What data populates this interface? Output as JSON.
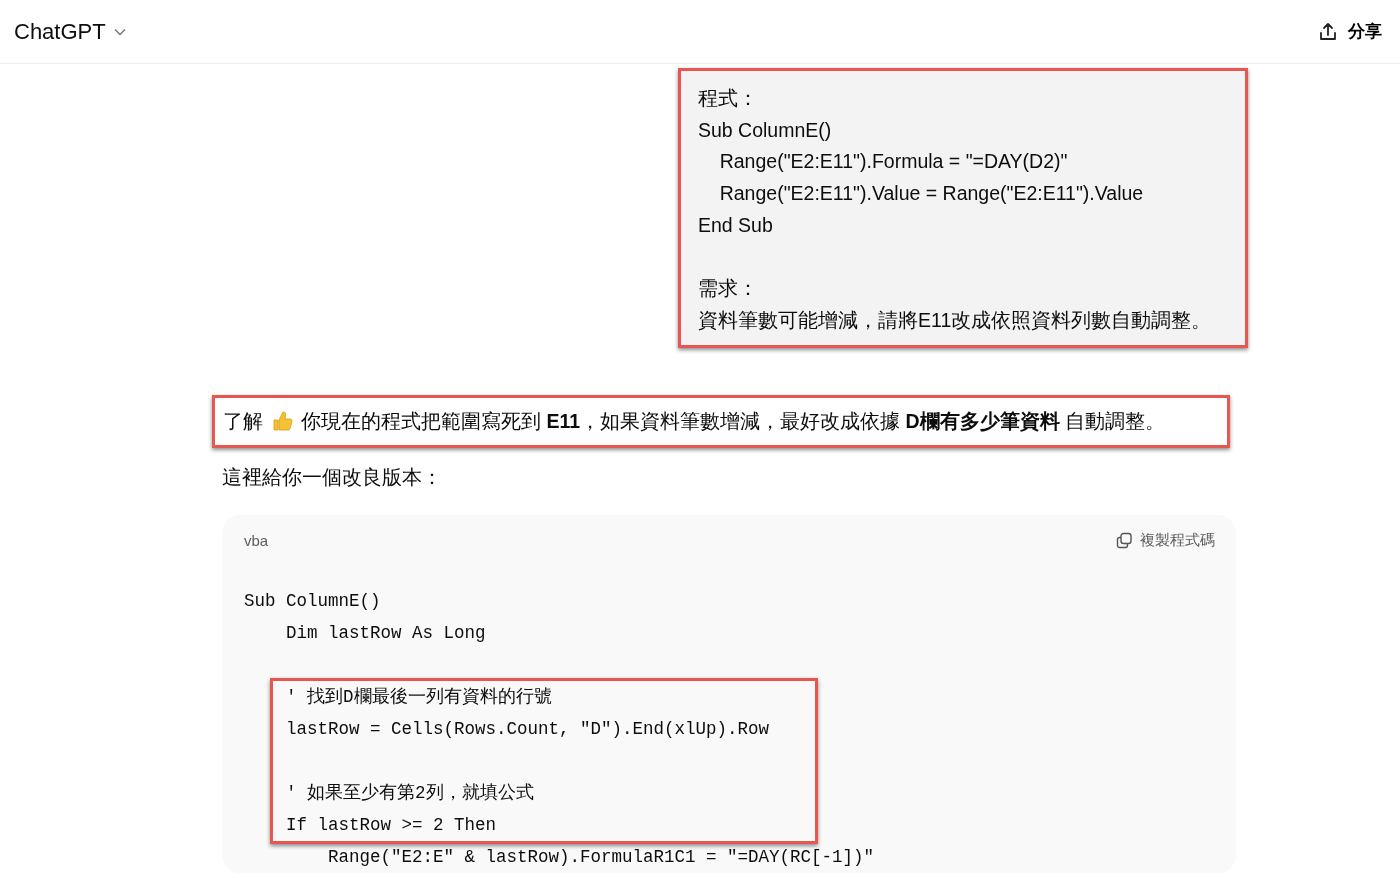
{
  "header": {
    "title": "ChatGPT",
    "share_label": "分享"
  },
  "user_message": {
    "highlighted": true,
    "paragraphs": [
      {
        "lines": [
          "程式：",
          "Sub ColumnE()",
          "    Range(\"E2:E11\").Formula = \"=DAY(D2)\"",
          "    Range(\"E2:E11\").Value = Range(\"E2:E11\").Value",
          "End Sub"
        ]
      },
      {
        "lines": [
          "需求：",
          "資料筆數可能增減，請將E11改成依照資料列數自動調整。"
        ]
      }
    ]
  },
  "reply": {
    "intro": {
      "highlighted": true,
      "before": "了解",
      "after": "你現在的程式把範圍寫死到 **E11**，如果資料筆數增減，最好改成依據 **D欄有多少筆資料** 自動調整。"
    },
    "lead": "這裡給你一個改良版本：",
    "code_block": {
      "language": "vba",
      "copy_label": "複製程式碼",
      "sections": [
        {
          "highlighted": false,
          "lines": [
            {
              "kind": "code",
              "text": "Sub ColumnE()"
            },
            {
              "kind": "code",
              "text": "    Dim lastRow As Long"
            },
            {
              "kind": "blank"
            }
          ]
        },
        {
          "highlighted": true,
          "lines": [
            {
              "kind": "comment",
              "text": "    ' 找到D欄最後一列有資料的行號"
            },
            {
              "kind": "code",
              "text": "    lastRow = Cells(Rows.Count, \"D\").End(xlUp).Row"
            },
            {
              "kind": "blank"
            },
            {
              "kind": "comment",
              "text": "    ' 如果至少有第2列，就填公式"
            },
            {
              "kind": "code",
              "text": "    If lastRow >= 2 Then"
            }
          ]
        },
        {
          "highlighted": false,
          "lines": [
            {
              "kind": "code",
              "text": "        Range(\"E2:E\" & lastRow).FormulaR1C1 = \"=DAY(RC[-1])\""
            }
          ]
        }
      ]
    }
  }
}
